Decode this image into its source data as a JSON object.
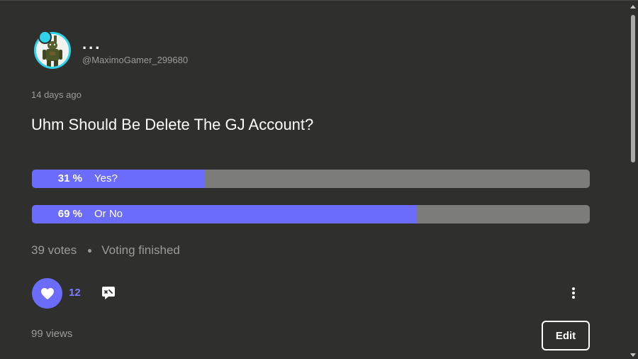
{
  "author": {
    "display_name": "...",
    "username": "@MaximoGamer_299680",
    "avatar_icon": "animatronic-avatar"
  },
  "post": {
    "timestamp": "14 days ago",
    "title": "Uhm Should Be Delete The GJ Account?"
  },
  "poll": {
    "options": [
      {
        "percent_label": "31 %",
        "label": "Yes?",
        "fraction": 0.31
      },
      {
        "percent_label": "69 %",
        "label": "Or No",
        "fraction": 0.69
      }
    ],
    "votes": "39 votes",
    "status": "Voting finished"
  },
  "actions": {
    "like_count": "12",
    "like_icon": "heart-icon",
    "comment_icon": "comment-icon",
    "more_icon": "more-vertical-icon"
  },
  "footer": {
    "views": "99 views",
    "edit_label": "Edit"
  },
  "colors": {
    "background": "#2f2f2d",
    "accent": "#6b6cfb",
    "poll_track": "#7c7c78",
    "muted_text": "#9b9b99",
    "avatar_ring": "#2fd4ec"
  }
}
